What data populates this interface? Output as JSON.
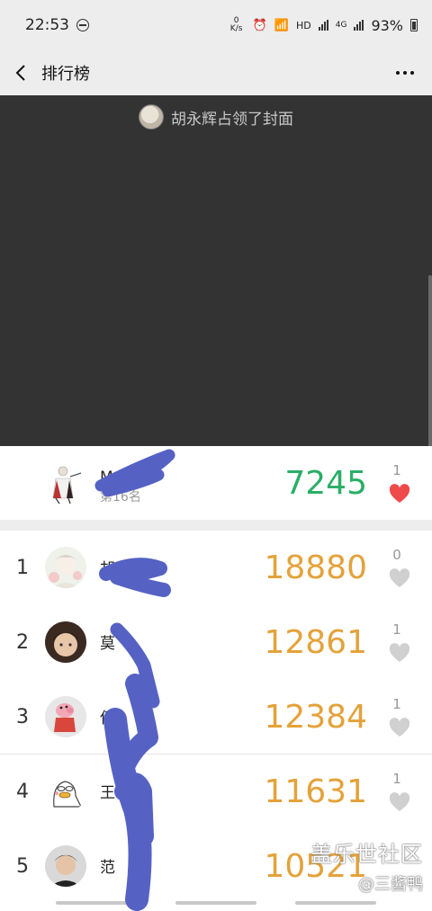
{
  "status_bar": {
    "time": "22:53",
    "net_speed": "0 K/s",
    "battery": "93%",
    "signal_labels": [
      "HD",
      "4G",
      "4G"
    ]
  },
  "header": {
    "title": "排行榜"
  },
  "cover": {
    "owner_text": "胡永辉占领了封面"
  },
  "my_entry": {
    "name": "M",
    "suffix": "小",
    "rank_text": "第16名",
    "steps": "7245",
    "likes": "1",
    "liked": true
  },
  "leaderboard": [
    {
      "rank": "1",
      "name": "胡",
      "steps": "18880",
      "likes": "0"
    },
    {
      "rank": "2",
      "name": "莫",
      "steps": "12861",
      "likes": "1"
    },
    {
      "rank": "3",
      "name": "伍",
      "steps": "12384",
      "likes": "1"
    },
    {
      "rank": "4",
      "name": "王",
      "steps": "11631",
      "likes": "1"
    },
    {
      "rank": "5",
      "name": "范",
      "steps": "10521",
      "likes": ""
    }
  ],
  "watermark": {
    "brand": "盖乐世社区",
    "user": "@三酱鸭"
  },
  "colors": {
    "my_steps": "#2aae67",
    "steps": "#e4a23a",
    "heart_liked": "#ef4b4b",
    "heart_unliked": "#d0d0d0",
    "scribble": "#5562c4"
  }
}
